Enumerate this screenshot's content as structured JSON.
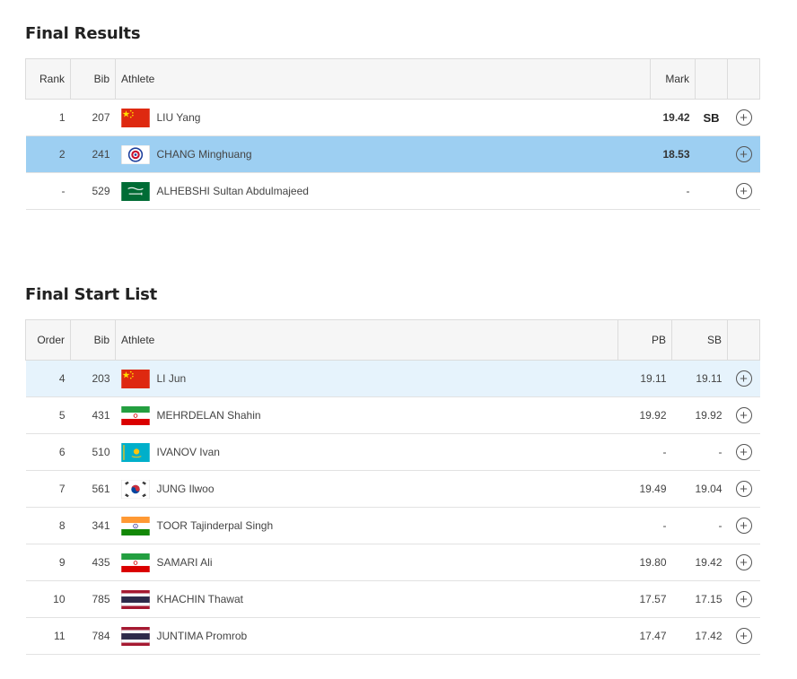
{
  "results": {
    "title": "Final Results",
    "columns": {
      "rank": "Rank",
      "bib": "Bib",
      "athlete": "Athlete",
      "mark": "Mark"
    },
    "rows": [
      {
        "rank": "1",
        "bib": "207",
        "name": "LIU Yang",
        "flag": "china-flag",
        "mark": "19.42",
        "badge": "SB"
      },
      {
        "rank": "2",
        "bib": "241",
        "name": "CHANG Minghuang",
        "flag": "chinese-taipei-flag",
        "mark": "18.53",
        "badge": ""
      },
      {
        "rank": "-",
        "bib": "529",
        "name": "ALHEBSHI Sultan Abdulmajeed",
        "flag": "saudi-arabia-flag",
        "mark": "-",
        "badge": ""
      }
    ]
  },
  "startlist": {
    "title": "Final Start List",
    "columns": {
      "order": "Order",
      "bib": "Bib",
      "athlete": "Athlete",
      "pb": "PB",
      "sb": "SB"
    },
    "rows": [
      {
        "order": "4",
        "bib": "203",
        "name": "LI Jun",
        "flag": "china-flag",
        "pb": "19.11",
        "sb": "19.11"
      },
      {
        "order": "5",
        "bib": "431",
        "name": "MEHRDELAN Shahin",
        "flag": "iran-flag",
        "pb": "19.92",
        "sb": "19.92"
      },
      {
        "order": "6",
        "bib": "510",
        "name": "IVANOV Ivan",
        "flag": "kazakhstan-flag",
        "pb": "-",
        "sb": "-"
      },
      {
        "order": "7",
        "bib": "561",
        "name": "JUNG Ilwoo",
        "flag": "korea-flag",
        "pb": "19.49",
        "sb": "19.04"
      },
      {
        "order": "8",
        "bib": "341",
        "name": "TOOR Tajinderpal Singh",
        "flag": "india-flag",
        "pb": "-",
        "sb": "-"
      },
      {
        "order": "9",
        "bib": "435",
        "name": "SAMARI Ali",
        "flag": "iran-flag",
        "pb": "19.80",
        "sb": "19.42"
      },
      {
        "order": "10",
        "bib": "785",
        "name": "KHACHIN Thawat",
        "flag": "thailand-flag",
        "pb": "17.57",
        "sb": "17.15"
      },
      {
        "order": "11",
        "bib": "784",
        "name": "JUNTIMA Promrob",
        "flag": "thailand-flag",
        "pb": "17.47",
        "sb": "17.42"
      }
    ]
  },
  "expand_icon": "plus-circle-icon",
  "colors": {
    "highlight_strong": "#9dcff2",
    "highlight_light": "#e6f3fc"
  }
}
